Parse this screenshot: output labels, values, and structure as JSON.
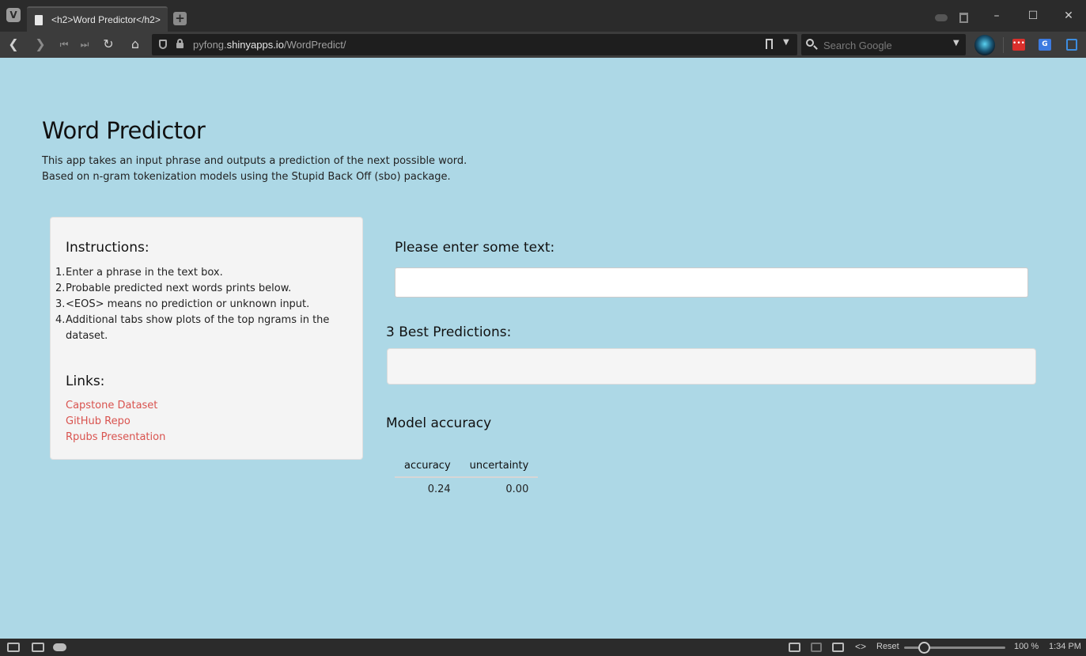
{
  "browser": {
    "tab_title": "<h2>Word Predictor</h2>",
    "url_prefix": "pyfong.",
    "url_host": "shinyapps.io",
    "url_path": "/WordPredict/",
    "search_placeholder": "Search Google"
  },
  "page": {
    "title": "Word Predictor",
    "description_lines": [
      "This app takes an input phrase and outputs a prediction of the next possible word.",
      "Based on n-gram tokenization models using the Stupid Back Off (sbo) package."
    ]
  },
  "sidebar": {
    "instructions_heading": "Instructions:",
    "instructions": [
      {
        "num": "1.",
        "text": "Enter a phrase in the text box."
      },
      {
        "num": "2.",
        "text": "Probable predicted next words prints below."
      },
      {
        "num": "3.",
        "text": "<EOS> means no prediction or unknown input."
      },
      {
        "num": "4.",
        "text": "Additional tabs show plots of the top ngrams in the dataset."
      }
    ],
    "links_heading": "Links:",
    "links": [
      "Capstone Dataset",
      "GitHub Repo",
      "Rpubs Presentation"
    ]
  },
  "main": {
    "text_label": "Please enter some text:",
    "text_value": "",
    "predictions_label": "3 Best Predictions:",
    "predictions_value": "",
    "accuracy_label": "Model accuracy",
    "table": {
      "headers": [
        "accuracy",
        "uncertainty"
      ],
      "row": [
        "0.24",
        "0.00"
      ]
    }
  },
  "statusbar": {
    "reset_label": "Reset",
    "zoom": "100 %",
    "zoom_fraction": 0.2,
    "time": "1:34 PM"
  },
  "colors": {
    "page_bg": "#add8e6",
    "link": "#d9534f",
    "panel_bg": "#f4f4f4"
  }
}
